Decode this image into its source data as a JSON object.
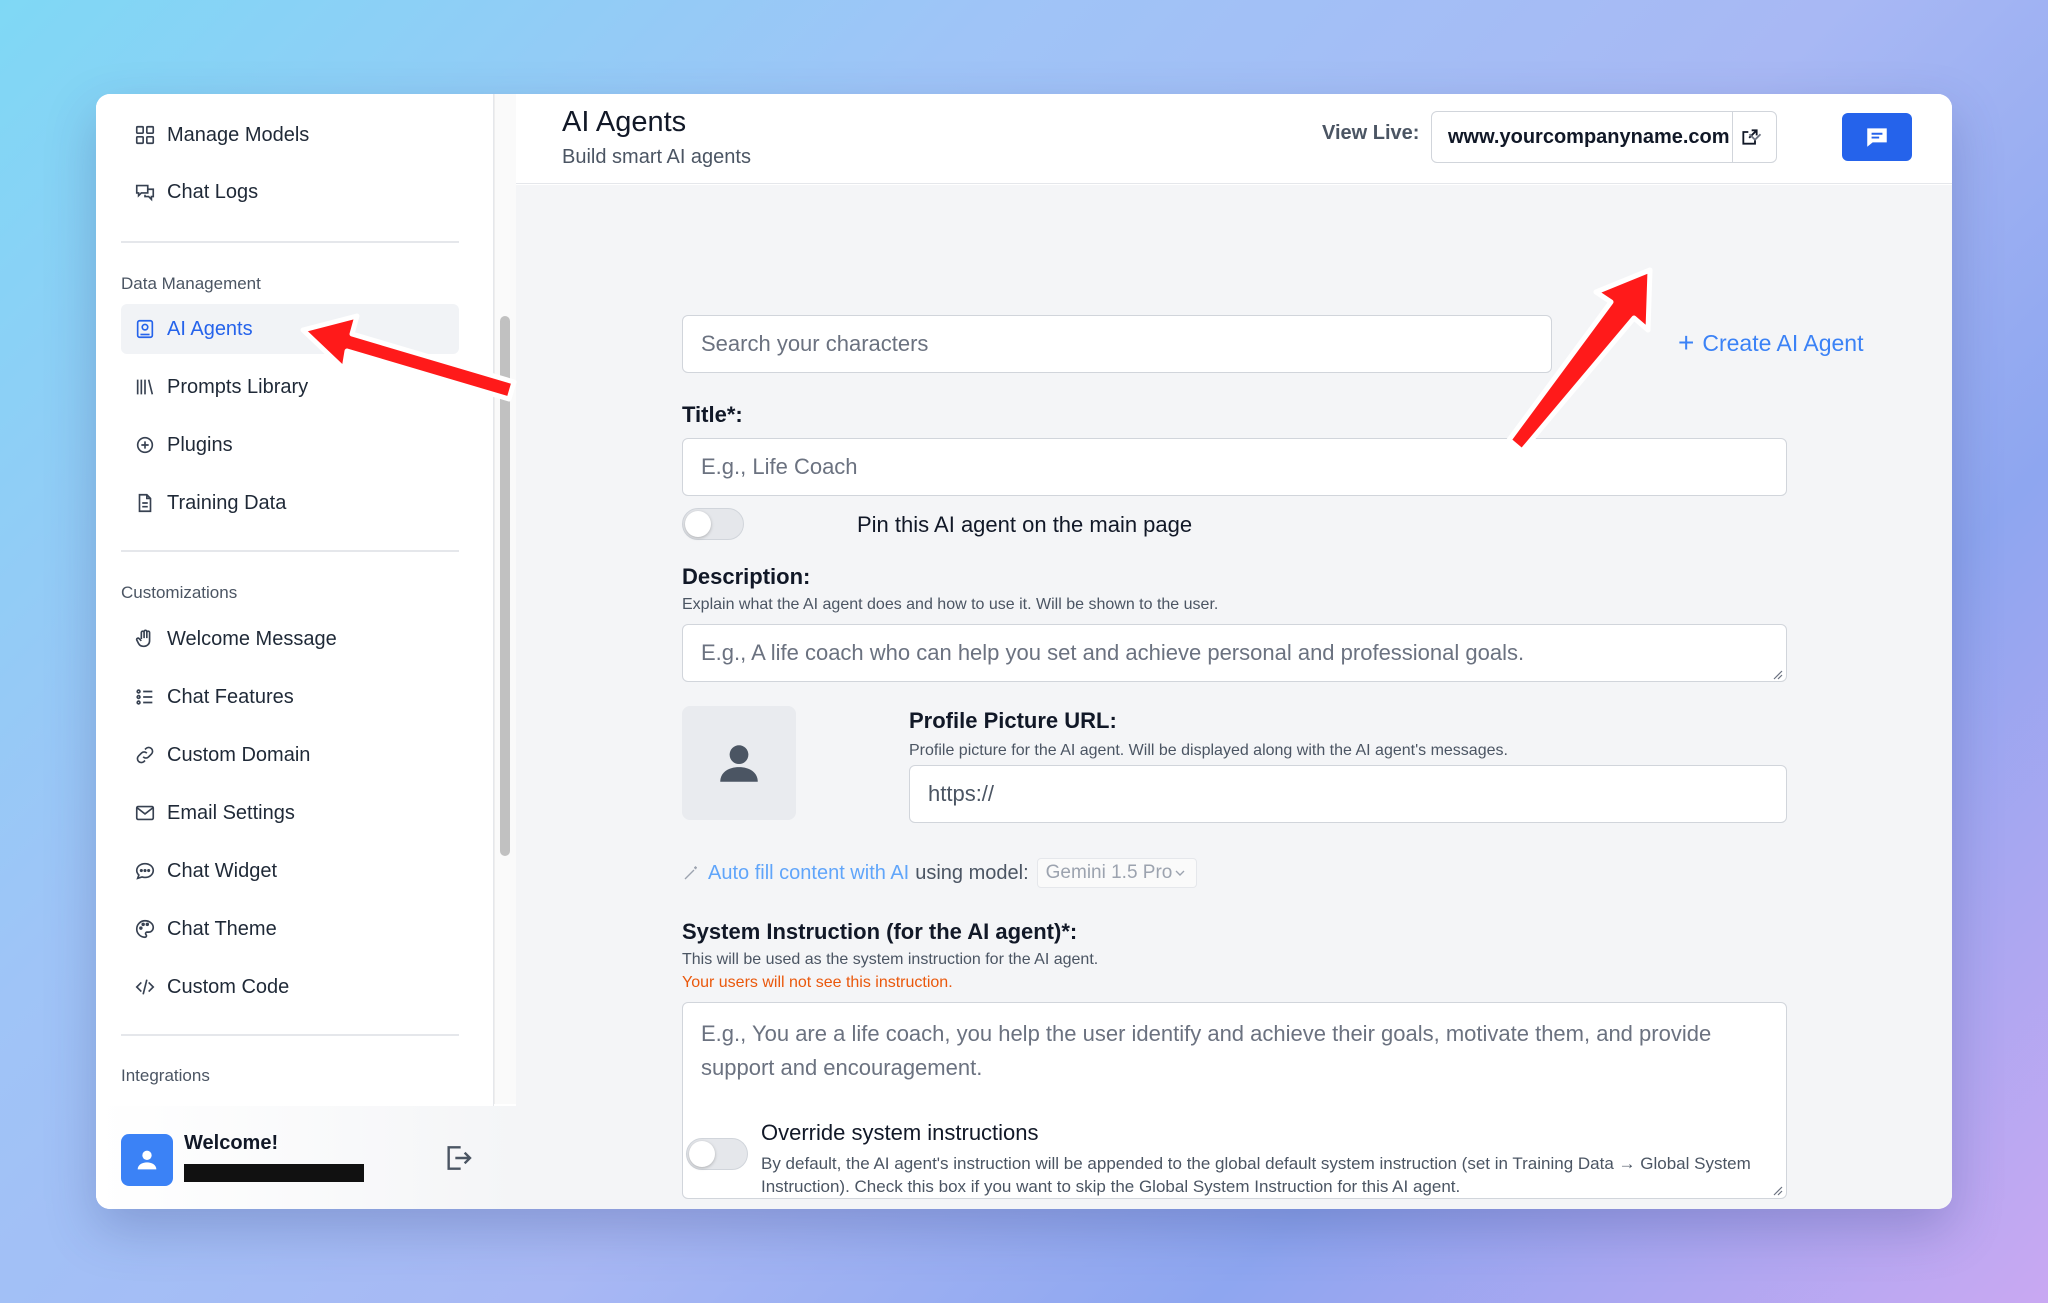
{
  "sidebar": {
    "top_items": [
      {
        "label": "Manage Models",
        "icon": "grid-icon"
      },
      {
        "label": "Chat Logs",
        "icon": "chat-bubbles-icon"
      }
    ],
    "sections": [
      {
        "title": "Data Management",
        "items": [
          {
            "label": "AI Agents",
            "icon": "agent-icon",
            "active": true
          },
          {
            "label": "Prompts Library",
            "icon": "library-icon"
          },
          {
            "label": "Plugins",
            "icon": "plus-circle-icon"
          },
          {
            "label": "Training Data",
            "icon": "document-icon"
          }
        ]
      },
      {
        "title": "Customizations",
        "items": [
          {
            "label": "Welcome Message",
            "icon": "hand-icon"
          },
          {
            "label": "Chat Features",
            "icon": "list-icon"
          },
          {
            "label": "Custom Domain",
            "icon": "link-icon"
          },
          {
            "label": "Email Settings",
            "icon": "mail-icon"
          },
          {
            "label": "Chat Widget",
            "icon": "chat-widget-icon"
          },
          {
            "label": "Chat Theme",
            "icon": "palette-icon"
          },
          {
            "label": "Custom Code",
            "icon": "code-icon"
          }
        ]
      },
      {
        "title": "Integrations",
        "items": []
      }
    ],
    "footer": {
      "welcome": "Welcome!"
    }
  },
  "header": {
    "title": "AI Agents",
    "subtitle": "Build smart AI agents",
    "view_live_label": "View Live:",
    "domain": "www.yourcompanyname.com"
  },
  "form": {
    "search_placeholder": "Search your characters",
    "create_label": "Create AI Agent",
    "title_label": "Title*:",
    "title_placeholder": "E.g., Life Coach",
    "pin_label": "Pin this AI agent on the main page",
    "description_label": "Description:",
    "description_help": "Explain what the AI agent does and how to use it. Will be shown to the user.",
    "description_placeholder": "E.g., A life coach who can help you set and achieve personal and professional goals.",
    "profile_label": "Profile Picture URL:",
    "profile_help": "Profile picture for the AI agent. Will be displayed along with the AI agent's messages.",
    "profile_placeholder": "https://",
    "autofill_link": "Auto fill content with AI",
    "autofill_rest": "using model:",
    "model_selected": "Gemini 1.5 Pro",
    "system_label": "System Instruction (for the AI agent)*:",
    "system_help": "This will be used as the system instruction for the AI agent.",
    "system_warning": "Your users will not see this instruction.",
    "system_placeholder": "E.g., You are a life coach, you help the user identify and achieve their goals, motivate them, and provide support and encouragement.",
    "override_label": "Override system instructions",
    "override_help": "By default, the AI agent's instruction will be appended to the global default system instruction (set in Training Data → Global System Instruction). Check this box if you want to skip the Global System Instruction for this AI agent."
  },
  "colors": {
    "accent": "#2563eb",
    "link": "#3b82f6",
    "warning": "#ea580c",
    "annotation_arrow": "#ff0000"
  }
}
